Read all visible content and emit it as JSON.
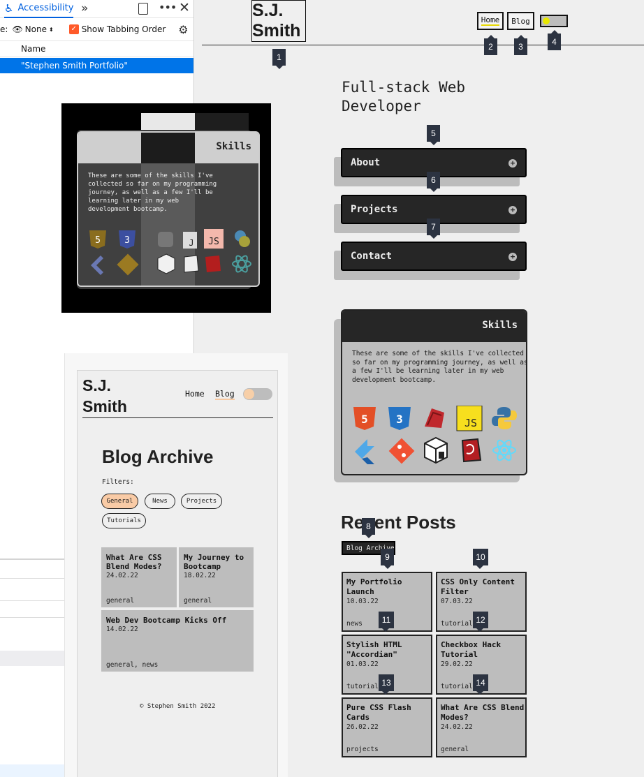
{
  "devtools": {
    "tab_label": "Accessibility",
    "filter_prefix": "e:",
    "filter_value": "None",
    "tabbing_label": "Show Tabbing Order",
    "column_header": "Name",
    "selected_row": "\"Stephen Smith Portfolio\""
  },
  "overlay": {
    "card_title": "Skills",
    "text_line_1": "These are some of the skills I've",
    "text_line_2": "collected so far on my programming",
    "text_line_3": "journey, as well as a few I'll be",
    "text_line_4": "learning later in my web",
    "text_line_5": "development bootcamp."
  },
  "blog": {
    "logo_line_1": "S.J.",
    "logo_line_2": "Smith",
    "nav_home": "Home",
    "nav_blog": "Blog",
    "title": "Blog Archive",
    "filters_label": "Filters:",
    "filters": [
      "General",
      "News",
      "Projects",
      "Tutorials"
    ],
    "posts": [
      {
        "title_1": "What Are CSS",
        "title_2": "Blend Modes?",
        "date": "24.02.22",
        "tags": "general"
      },
      {
        "title_1": "My Journey to",
        "title_2": "Bootcamp",
        "date": "18.02.22",
        "tags": "general"
      },
      {
        "title_1": "Web Dev Bootcamp Kicks Off",
        "title_2": "",
        "date": "14.02.22",
        "tags": "general, news"
      }
    ],
    "footer": "© Stephen Smith 2022"
  },
  "main": {
    "logo_line_1": "S.J.",
    "logo_line_2": "Smith",
    "nav_home": "Home",
    "nav_blog": "Blog",
    "hero_line_1": "Full-stack Web",
    "hero_line_2": "Developer",
    "accordions": [
      "About",
      "Projects",
      "Contact"
    ],
    "skills_title": "Skills",
    "skills_line_1": "These are some of the skills I've collected",
    "skills_line_2": "so far on my programming journey, as well as",
    "skills_line_3": "a few I'll be learning later in my web",
    "skills_line_4": "development bootcamp.",
    "recent_title": "Recent Posts",
    "archive_button": "Blog Archive",
    "posts": [
      {
        "title_1": "My Portfolio",
        "title_2": "Launch",
        "date": "10.03.22",
        "tags": "news"
      },
      {
        "title_1": "CSS Only Content",
        "title_2": "Filter",
        "date": "07.03.22",
        "tags": "tutorials"
      },
      {
        "title_1": "Stylish HTML",
        "title_2": "\"Accordian\"",
        "date": "01.03.22",
        "tags": "tutorials"
      },
      {
        "title_1": "Checkbox Hack",
        "title_2": "Tutorial",
        "date": "29.02.22",
        "tags": "tutorials"
      },
      {
        "title_1": "Pure CSS Flash",
        "title_2": "Cards",
        "date": "26.02.22",
        "tags": "projects"
      },
      {
        "title_1": "What Are CSS Blend",
        "title_2": "Modes?",
        "date": "24.02.22",
        "tags": "general"
      }
    ],
    "tab_badges": [
      "1",
      "2",
      "3",
      "4",
      "5",
      "6",
      "7",
      "8",
      "9",
      "10",
      "11",
      "12",
      "13",
      "14"
    ]
  },
  "icons": [
    "html5-icon",
    "css3-icon",
    "sass-icon",
    "js-icon",
    "python-icon",
    "flutter-icon",
    "git-icon",
    "cube-icon",
    "ruby-icon",
    "react-icon"
  ]
}
